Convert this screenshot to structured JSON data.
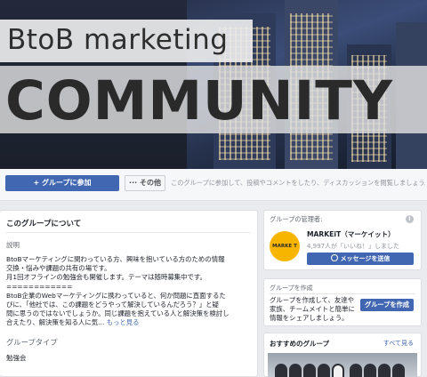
{
  "cover": {
    "title_line1": "BtoB marketing",
    "title_line2": "COMMUNITY"
  },
  "actions": {
    "join_label": "+ グループに参加",
    "more_label": "··· その他",
    "hint": "このグループに参加して、投稿やコメントをしたり、ディスカッションを閲覧しましょう。"
  },
  "about": {
    "title": "このグループについて",
    "subtitle": "説明",
    "description": [
      "BtoBマーケティングに関わっている方、興味を抱いている方のための情報",
      "交換・悩みや課題の共有の場です。",
      "月1回オフラインの勉強会も開催します。テーマは随時募集中です。",
      "============",
      "BtoB企業のWebマーケティングに携わっていると、何か問題に直面するた",
      "びに、「他社では、この課題をどうやって解決しているんだろう？」と疑",
      "問に思うのではないでしょうか。同じ課題を抱えている人と解決策を検討し",
      "合えたり、解決策を知る人に気..."
    ],
    "more_link": "もっと見る",
    "type_label": "グループタイプ",
    "type_value": "勉強会"
  },
  "admin": {
    "heading": "グループの管理者:",
    "info_icon": "i",
    "logo_text": "MARKE T",
    "name": "MARKEiT（マーケイット）",
    "likes": "4,997人が「いいね！」しました",
    "message_button": "メッセージを送信"
  },
  "create_group": {
    "heading": "グループを作成",
    "body": "グループを作成して、友達や家族、チームメイトと簡単に情報をシェアしましょう。",
    "button": "グループを作成"
  },
  "suggested": {
    "heading": "おすすめのグループ",
    "see_all": "すべて見る"
  },
  "colors": {
    "brand_blue": "#4267b2",
    "page_bg": "#e9ebee",
    "logo_yellow": "#f7b500"
  }
}
